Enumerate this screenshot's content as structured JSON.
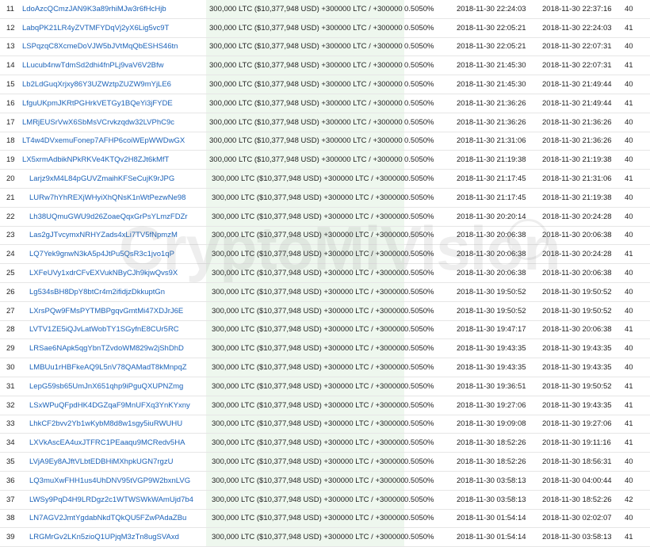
{
  "balance_usd": "($10,377,948 USD)",
  "balance_ltc": "300,000 LTC",
  "change_in": "+300000 LTC",
  "change_out": "+300000 LTC",
  "watermark_text": "CryptoMiVision",
  "colors": {
    "link": "#1b62b8",
    "highlight_column": "#eef7ee",
    "change": "#3c9a3c"
  },
  "rows": [
    {
      "rank": "11",
      "address": "LdoAzcQCmzJAN9K3a89rhiMJw3r6fHcHjb",
      "pct": "0.5050%",
      "first_in": "2018-11-30 22:24:03",
      "last_in": "2018-11-30 22:37:16",
      "ins": "40"
    },
    {
      "rank": "12",
      "address": "LabqPK21LR4yZVTMFYDqVj2yX6Lig5vc9T",
      "pct": "0.5050%",
      "first_in": "2018-11-30 22:05:21",
      "last_in": "2018-11-30 22:24:03",
      "ins": "41"
    },
    {
      "rank": "13",
      "address": "LSPqzqC8XcmeDoVJW5bJVtMqQbESHS46tn",
      "pct": "0.5050%",
      "first_in": "2018-11-30 22:05:21",
      "last_in": "2018-11-30 22:07:31",
      "ins": "40"
    },
    {
      "rank": "14",
      "address": "LLucub4nwTdmSd2dhi4fnPLj9vaV6V2Bfw",
      "pct": "0.5050%",
      "first_in": "2018-11-30 21:45:30",
      "last_in": "2018-11-30 22:07:31",
      "ins": "41"
    },
    {
      "rank": "15",
      "address": "Lb2LdGuqXrjxy86Y3UZWztpZUZW9mYjLE6",
      "pct": "0.5050%",
      "first_in": "2018-11-30 21:45:30",
      "last_in": "2018-11-30 21:49:44",
      "ins": "40"
    },
    {
      "rank": "16",
      "address": "LfguUKpmJKRtPGHrkVETGy1BQeYi3jFYDE",
      "pct": "0.5050%",
      "first_in": "2018-11-30 21:36:26",
      "last_in": "2018-11-30 21:49:44",
      "ins": "41"
    },
    {
      "rank": "17",
      "address": "LMRjEUSrVwX6SbMsVCrvkzqdw32LVPhC9c",
      "pct": "0.5050%",
      "first_in": "2018-11-30 21:36:26",
      "last_in": "2018-11-30 21:36:26",
      "ins": "40"
    },
    {
      "rank": "18",
      "address": "LT4w4DVxemuFonep7AFHP6coiWEpWWDwGX",
      "pct": "0.5050%",
      "first_in": "2018-11-30 21:31:06",
      "last_in": "2018-11-30 21:36:26",
      "ins": "40"
    },
    {
      "rank": "19",
      "address": "LX5xrmAdbikNPkRKVe4KTQv2H8ZJt6kMfT",
      "pct": "0.5050%",
      "first_in": "2018-11-30 21:19:38",
      "last_in": "2018-11-30 21:19:38",
      "ins": "40"
    },
    {
      "rank": "20",
      "address": "Larjz9xM4L84pGUVZmaihKFSeCujK9rJPG",
      "pct": "0.5050%",
      "first_in": "2018-11-30 21:17:45",
      "last_in": "2018-11-30 21:31:06",
      "ins": "41"
    },
    {
      "rank": "21",
      "address": "LURw7hYhREXjWHyiXhQNsK1nWtPezwNe98",
      "pct": "0.5050%",
      "first_in": "2018-11-30 21:17:45",
      "last_in": "2018-11-30 21:19:38",
      "ins": "40"
    },
    {
      "rank": "22",
      "address": "Lh38UQmuGWU9d26ZoaeQqxGrPsYLmzFDZr",
      "pct": "0.5050%",
      "first_in": "2018-11-30 20:20:14",
      "last_in": "2018-11-30 20:24:28",
      "ins": "40"
    },
    {
      "rank": "23",
      "address": "Las2gJTvcymxNRHYZads4xLi7TV5fNpmzM",
      "pct": "0.5050%",
      "first_in": "2018-11-30 20:06:38",
      "last_in": "2018-11-30 20:06:38",
      "ins": "40"
    },
    {
      "rank": "24",
      "address": "LQ7Yek9gnwN3kA5p4JtPu5QsR3c1jvo1qP",
      "pct": "0.5050%",
      "first_in": "2018-11-30 20:06:38",
      "last_in": "2018-11-30 20:24:28",
      "ins": "41"
    },
    {
      "rank": "25",
      "address": "LXFeUVy1xdrCFvEXVukNByCJh9kjwQvs9X",
      "pct": "0.5050%",
      "first_in": "2018-11-30 20:06:38",
      "last_in": "2018-11-30 20:06:38",
      "ins": "40"
    },
    {
      "rank": "26",
      "address": "Lg534sBH8DpY8btCr4m2ifidjzDkkuptGn",
      "pct": "0.5050%",
      "first_in": "2018-11-30 19:50:52",
      "last_in": "2018-11-30 19:50:52",
      "ins": "40"
    },
    {
      "rank": "27",
      "address": "LXrsPQw9FMsPYTMBPgqvGmtMi47XDJrJ6E",
      "pct": "0.5050%",
      "first_in": "2018-11-30 19:50:52",
      "last_in": "2018-11-30 19:50:52",
      "ins": "40"
    },
    {
      "rank": "28",
      "address": "LVTV1ZE5iQJvLatWobTY1SGyfnE8CUr5RC",
      "pct": "0.5050%",
      "first_in": "2018-11-30 19:47:17",
      "last_in": "2018-11-30 20:06:38",
      "ins": "41"
    },
    {
      "rank": "29",
      "address": "LRSae6NApk5qgYbnTZvdoWM829w2jShDhD",
      "pct": "0.5050%",
      "first_in": "2018-11-30 19:43:35",
      "last_in": "2018-11-30 19:43:35",
      "ins": "40"
    },
    {
      "rank": "30",
      "address": "LMBUu1rHBFkeAQ9L5nV78QAMadT8kMnpqZ",
      "pct": "0.5050%",
      "first_in": "2018-11-30 19:43:35",
      "last_in": "2018-11-30 19:43:35",
      "ins": "40"
    },
    {
      "rank": "31",
      "address": "LepG59sb65UmJnX651qhp9iPguQXUPNZmg",
      "pct": "0.5050%",
      "first_in": "2018-11-30 19:36:51",
      "last_in": "2018-11-30 19:50:52",
      "ins": "41"
    },
    {
      "rank": "32",
      "address": "LSxWPuQFpdHK4DGZqaF9MnUFXq3YnKYxny",
      "pct": "0.5050%",
      "first_in": "2018-11-30 19:27:06",
      "last_in": "2018-11-30 19:43:35",
      "ins": "41"
    },
    {
      "rank": "33",
      "address": "LhkCF2bvv2Yb1wKybM8d8w1sgy5iuRWUHU",
      "pct": "0.5050%",
      "first_in": "2018-11-30 19:09:08",
      "last_in": "2018-11-30 19:27:06",
      "ins": "41"
    },
    {
      "rank": "34",
      "address": "LXVkAscEA4uxJTFRC1PEaaqu9MCRedv5HA",
      "pct": "0.5050%",
      "first_in": "2018-11-30 18:52:26",
      "last_in": "2018-11-30 19:11:16",
      "ins": "41"
    },
    {
      "rank": "35",
      "address": "LVjA9Ey8AJftVLbtEDBHiMXhpkUGN7rgzU",
      "pct": "0.5050%",
      "first_in": "2018-11-30 18:52:26",
      "last_in": "2018-11-30 18:56:31",
      "ins": "40"
    },
    {
      "rank": "36",
      "address": "LQ3muXwFHH1us4UhDNV95tVGP9W2bxnLVG",
      "pct": "0.5050%",
      "first_in": "2018-11-30 03:58:13",
      "last_in": "2018-11-30 04:00:44",
      "ins": "40"
    },
    {
      "rank": "37",
      "address": "LWSy9PqD4H9LRDgz2c1WTWSWkWAmUjd7b4",
      "pct": "0.5050%",
      "first_in": "2018-11-30 03:58:13",
      "last_in": "2018-11-30 18:52:26",
      "ins": "42"
    },
    {
      "rank": "38",
      "address": "LN7AGV2JmtYgdabNkdTQkQU5FZwPAdaZBu",
      "pct": "0.5050%",
      "first_in": "2018-11-30 01:54:14",
      "last_in": "2018-11-30 02:02:07",
      "ins": "40"
    },
    {
      "rank": "39",
      "address": "LRGMrGv2LKn5zioQ1UPjqM3zTn8ugSVAxd",
      "pct": "0.5050%",
      "first_in": "2018-11-30 01:54:14",
      "last_in": "2018-11-30 03:58:13",
      "ins": "41"
    }
  ]
}
